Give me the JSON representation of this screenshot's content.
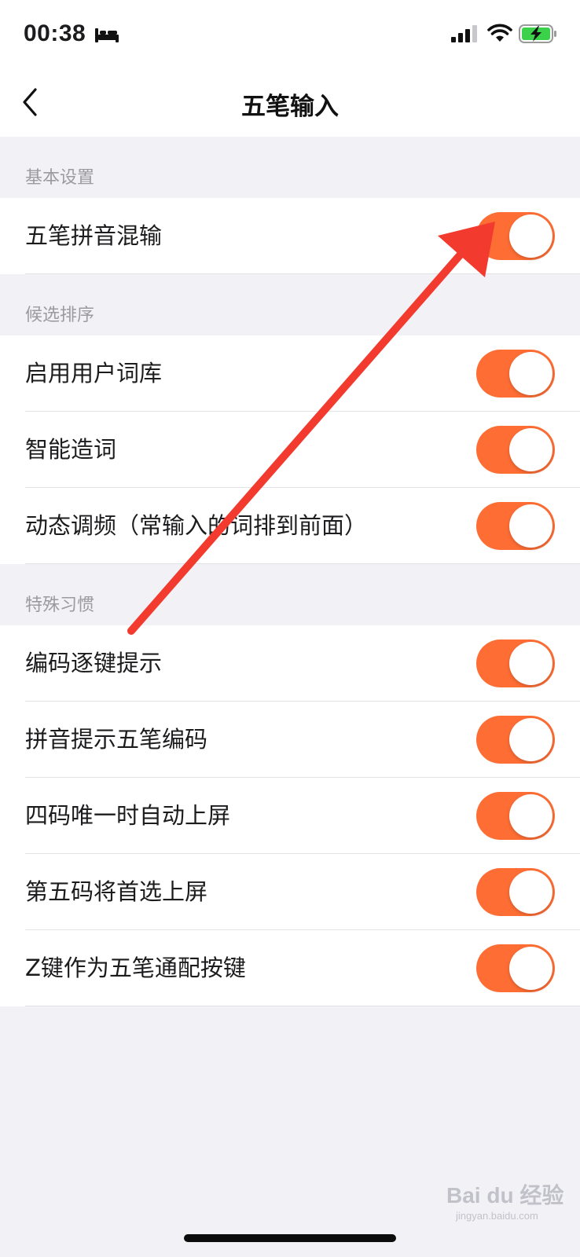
{
  "status_bar": {
    "time": "00:38",
    "icons": [
      "bed-icon",
      "cellular-signal-icon",
      "wifi-icon",
      "battery-charging-icon"
    ]
  },
  "nav": {
    "title": "五笔输入",
    "back_icon": "chevron-left-icon"
  },
  "sections": [
    {
      "header": "基本设置",
      "rows": [
        {
          "label": "五笔拼音混输",
          "on": true
        }
      ]
    },
    {
      "header": "候选排序",
      "rows": [
        {
          "label": "启用用户词库",
          "on": true
        },
        {
          "label": "智能造词",
          "on": true
        },
        {
          "label": "动态调频（常输入的词排到前面）",
          "on": true
        }
      ]
    },
    {
      "header": "特殊习惯",
      "rows": [
        {
          "label": "编码逐键提示",
          "on": true
        },
        {
          "label": "拼音提示五笔编码",
          "on": true
        },
        {
          "label": "四码唯一时自动上屏",
          "on": true
        },
        {
          "label": "第五码将首选上屏",
          "on": true
        },
        {
          "label": "Z键作为五笔通配按键",
          "on": true
        }
      ]
    }
  ],
  "colors": {
    "accent": "#fe6d34",
    "annotation_arrow": "#f23b2e",
    "background": "#f2f2f6",
    "section_header_text": "#9a9aa0"
  },
  "watermark": {
    "brand": "Bai du 经验",
    "url": "jingyan.baidu.com"
  }
}
